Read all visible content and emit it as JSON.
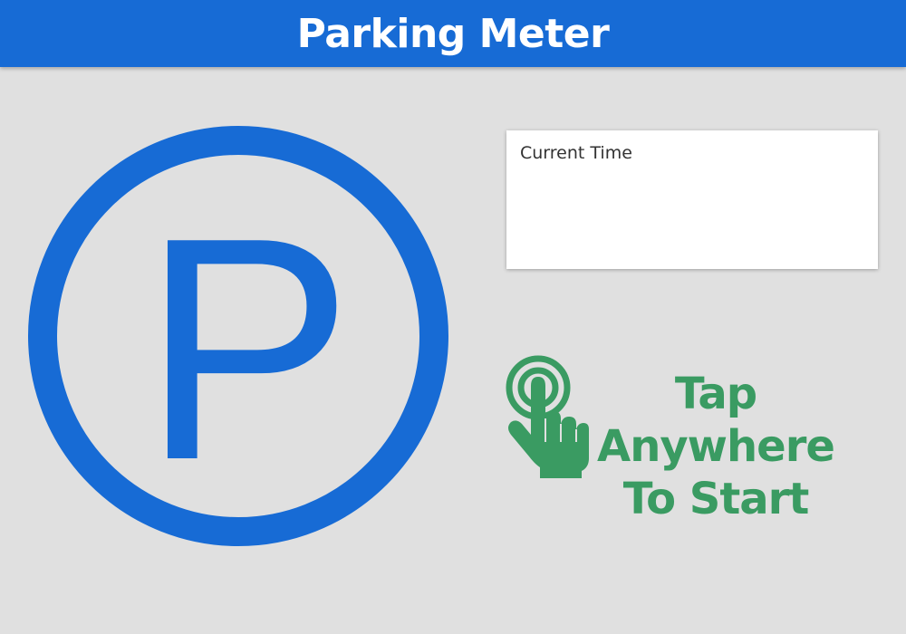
{
  "header": {
    "title": "Parking Meter"
  },
  "parking_sign": {
    "letter": "P",
    "color": "#176bd5",
    "icon": "parking-sign-icon"
  },
  "time_card": {
    "label": "Current Time",
    "value": ""
  },
  "tap_prompt": {
    "line1": "Tap",
    "line2": "Anywhere",
    "line3": "To Start",
    "color": "#3a9b62",
    "icon": "tap-hand-icon"
  },
  "colors": {
    "header_bg": "#176bd5",
    "page_bg": "#e0e0e0",
    "card_bg": "#ffffff"
  }
}
